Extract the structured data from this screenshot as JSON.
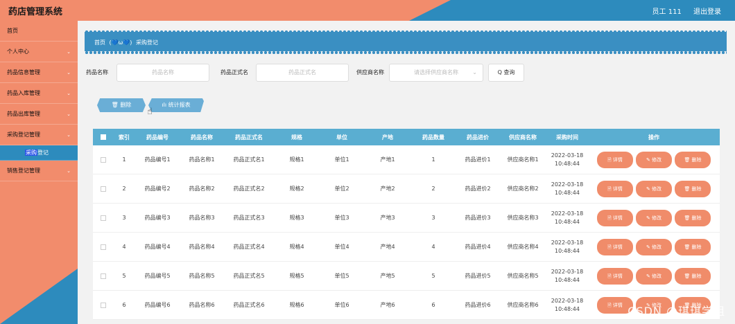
{
  "app": {
    "title": "药店管理系统"
  },
  "header": {
    "user": "员工 111",
    "logout": "退出登录"
  },
  "sidebar": {
    "items": [
      {
        "label": "首页",
        "chevron": ""
      },
      {
        "label": "个人中心",
        "chevron": "⌄"
      },
      {
        "label": "药品信息管理",
        "chevron": "⌄"
      },
      {
        "label": "药品入库管理",
        "chevron": "⌄"
      },
      {
        "label": "药品出库管理",
        "chevron": "⌄"
      },
      {
        "label": "采购登记管理",
        "chevron": "⌄"
      },
      {
        "label": "销售登记管理",
        "chevron": "⌄"
      }
    ],
    "sub": {
      "hl": "采购",
      "rest": "登记"
    }
  },
  "breadcrumb": {
    "home": "首页",
    "sep": "(💙ω💙)",
    "current": "采购登记"
  },
  "search": {
    "name_label": "药品名称",
    "name_placeholder": "药品名称",
    "fname_label": "药品正式名",
    "fname_placeholder": "药品正式名",
    "sup_label": "供应商名称",
    "sup_placeholder": "请选择供应商名称",
    "query": "Q 查询"
  },
  "actions": {
    "delete": "🗑 删除",
    "stats": "ılı 统计报表"
  },
  "table": {
    "headers": [
      "索引",
      "药品编号",
      "药品名称",
      "药品正式名",
      "规格",
      "单位",
      "产地",
      "药品数量",
      "药品进价",
      "供应商名称",
      "采购时间",
      "操作"
    ],
    "rows": [
      {
        "idx": "1",
        "code": "药品编号1",
        "name": "药品名称1",
        "fname": "药品正式名1",
        "spec": "规格1",
        "unit": "单位1",
        "origin": "产地1",
        "qty": "1",
        "price": "药品进价1",
        "sup": "供应商名称1",
        "date": "2022-03-18",
        "time": "10:48:44"
      },
      {
        "idx": "2",
        "code": "药品编号2",
        "name": "药品名称2",
        "fname": "药品正式名2",
        "spec": "规格2",
        "unit": "单位2",
        "origin": "产地2",
        "qty": "2",
        "price": "药品进价2",
        "sup": "供应商名称2",
        "date": "2022-03-18",
        "time": "10:48:44"
      },
      {
        "idx": "3",
        "code": "药品编号3",
        "name": "药品名称3",
        "fname": "药品正式名3",
        "spec": "规格3",
        "unit": "单位3",
        "origin": "产地3",
        "qty": "3",
        "price": "药品进价3",
        "sup": "供应商名称3",
        "date": "2022-03-18",
        "time": "10:48:44"
      },
      {
        "idx": "4",
        "code": "药品编号4",
        "name": "药品名称4",
        "fname": "药品正式名4",
        "spec": "规格4",
        "unit": "单位4",
        "origin": "产地4",
        "qty": "4",
        "price": "药品进价4",
        "sup": "供应商名称4",
        "date": "2022-03-18",
        "time": "10:48:44"
      },
      {
        "idx": "5",
        "code": "药品编号5",
        "name": "药品名称5",
        "fname": "药品正式名5",
        "spec": "规格5",
        "unit": "单位5",
        "origin": "产地5",
        "qty": "5",
        "price": "药品进价5",
        "sup": "供应商名称5",
        "date": "2022-03-18",
        "time": "10:48:44"
      },
      {
        "idx": "6",
        "code": "药品编号6",
        "name": "药品名称6",
        "fname": "药品正式名6",
        "spec": "规格6",
        "unit": "单位6",
        "origin": "产地6",
        "qty": "6",
        "price": "药品进价6",
        "sup": "供应商名称6",
        "date": "2022-03-18",
        "time": "10:48:44"
      }
    ],
    "ops": {
      "detail": "🗎 详情",
      "edit": "✎ 修改",
      "delete": "🗑 删除"
    }
  },
  "watermark": "CSDN @琪琪学姐",
  "colors": {
    "accent_orange": "#f28c6c",
    "accent_blue": "#2d8bbd",
    "table_head": "#5aaed1"
  }
}
